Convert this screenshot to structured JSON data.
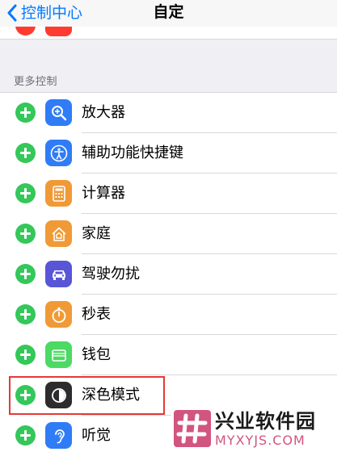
{
  "navbar": {
    "back_label": "控制中心",
    "title": "自定"
  },
  "section": {
    "header": "更多控制"
  },
  "items": [
    {
      "label": "放大器",
      "icon": "magnifier-icon",
      "color": "#2f7cf6"
    },
    {
      "label": "辅助功能快捷键",
      "icon": "accessibility-icon",
      "color": "#2f7cf6"
    },
    {
      "label": "计算器",
      "icon": "calculator-icon",
      "color": "#f09a37"
    },
    {
      "label": "家庭",
      "icon": "home-icon",
      "color": "#f09a37"
    },
    {
      "label": "驾驶勿扰",
      "icon": "car-icon",
      "color": "#5856d6"
    },
    {
      "label": "秒表",
      "icon": "stopwatch-icon",
      "color": "#f09a37"
    },
    {
      "label": "钱包",
      "icon": "wallet-icon",
      "color": "#4cd964"
    },
    {
      "label": "深色模式",
      "icon": "dark-mode-icon",
      "color": "#2c2c2e"
    },
    {
      "label": "听觉",
      "icon": "ear-icon",
      "color": "#2f7cf6"
    }
  ],
  "colors": {
    "accent": "#007aff",
    "add": "#34c759",
    "highlight": "#e53935"
  },
  "watermark": {
    "title": "兴业软件园",
    "url": "MYXYJS.COM"
  }
}
